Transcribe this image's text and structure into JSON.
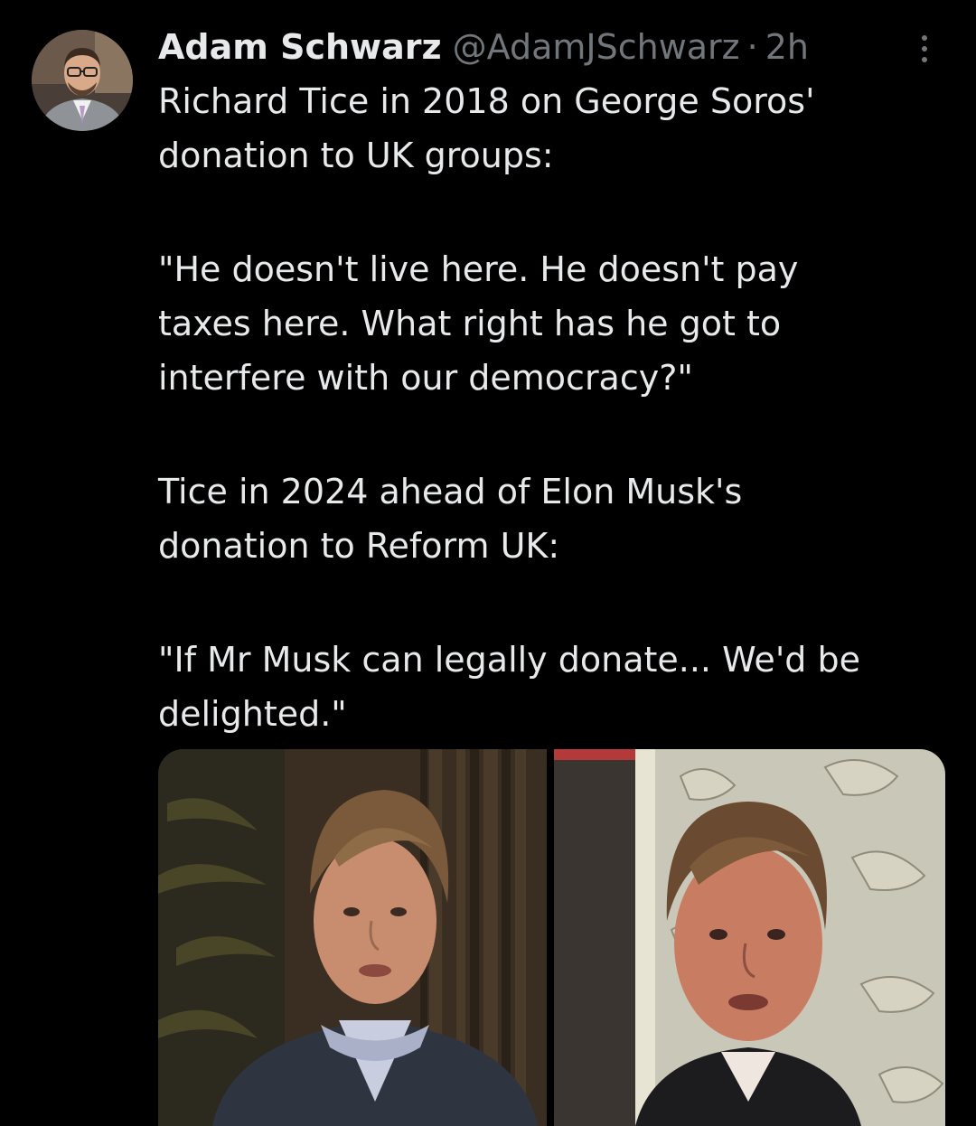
{
  "tweet": {
    "author": {
      "display_name": "Adam Schwarz",
      "handle": "@AdamJSchwarz",
      "separator": "·",
      "time": "2h"
    },
    "more_icon": "more-vertical-icon",
    "text": {
      "para1_line1": "Richard Tice in 2018 on George Soros'",
      "para1_line2": "donation to UK groups:",
      "para2_line1": "\"He doesn't live here. He doesn't pay",
      "para2_line2": "taxes here. What right has he got to",
      "para2_line3": "interfere with our democracy?\"",
      "para3_line1": "Tice in 2024 ahead of Elon Musk's",
      "para3_line2": "donation to Reform UK:",
      "para4_line1": "\"If Mr Musk can legally donate... We'd be",
      "para4_line2": "delighted.\""
    }
  },
  "colors": {
    "background": "#000000",
    "primary_text": "#e7e9ea",
    "secondary_text": "#71767b"
  }
}
